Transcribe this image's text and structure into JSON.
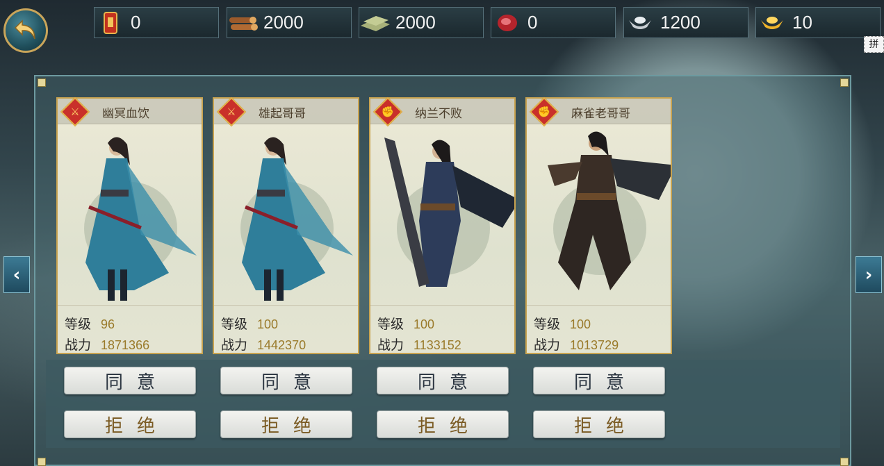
{
  "resources": [
    {
      "icon": "token-icon",
      "value": "0"
    },
    {
      "icon": "wood-icon",
      "value": "2000"
    },
    {
      "icon": "stone-icon",
      "value": "2000"
    },
    {
      "icon": "meat-icon",
      "value": "0"
    },
    {
      "icon": "silver-icon",
      "value": "1200"
    },
    {
      "icon": "gold-ingot-icon",
      "value": "10"
    }
  ],
  "side_tab": "拼",
  "labels": {
    "level": "等级",
    "power": "战力",
    "agree": "同意",
    "refuse": "拒绝"
  },
  "cards": [
    {
      "name": "幽冥血饮",
      "class_icon": "swords-icon",
      "level": "96",
      "power": "1871366"
    },
    {
      "name": "雄起哥哥",
      "class_icon": "swords-icon",
      "level": "100",
      "power": "1442370"
    },
    {
      "name": "纳兰不败",
      "class_icon": "fist-icon",
      "level": "100",
      "power": "1133152"
    },
    {
      "name": "麻雀老哥哥",
      "class_icon": "fist-icon",
      "level": "100",
      "power": "1013729"
    }
  ],
  "colors": {
    "accent_gold": "#c8a350",
    "panel": "#466e72"
  }
}
